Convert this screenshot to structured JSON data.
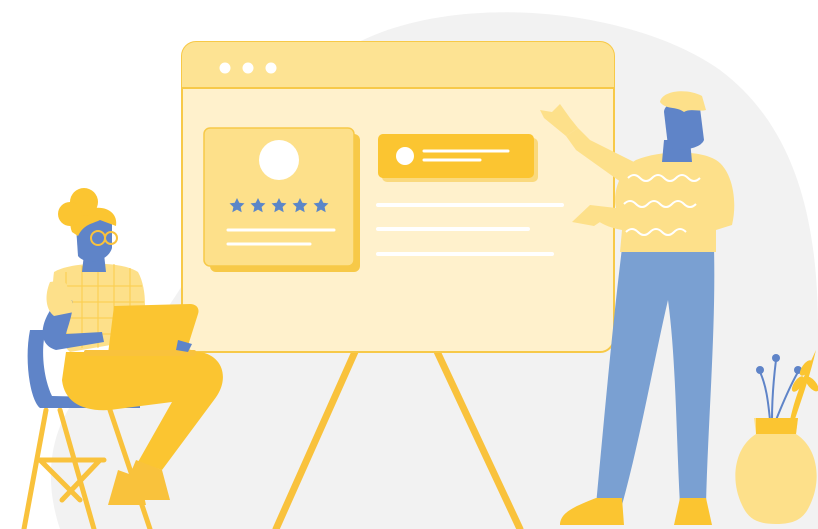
{
  "scene": {
    "board": {
      "window_dots": 3,
      "rating_stars": 5,
      "text_lines": 3
    },
    "icons": {
      "star": "star-icon",
      "avatar": "avatar-placeholder-icon"
    },
    "colors": {
      "background_blob": "#f2f2f2",
      "board_fill": "#fff1cc",
      "board_header": "#fde393",
      "board_border": "#f7c948",
      "card_fill": "#fde08a",
      "accent_yellow": "#fbc531",
      "easel_leg": "#f9c23c",
      "skin_blue": "#5f84c8",
      "pants_blue": "#7aa0d2",
      "star_blue": "#5b86c8",
      "hair_yellow": "#f9c23c",
      "white": "#ffffff"
    }
  }
}
